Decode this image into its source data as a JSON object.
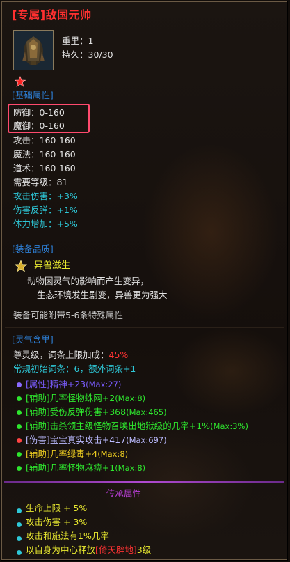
{
  "title": "[专属]敌国元帅",
  "weight": "重里：1",
  "durability": "持久：30/30",
  "basic": {
    "header": "[基础属性]",
    "lines": [
      "防御：0-160",
      "魔御：0-160",
      "攻击：160-160",
      "魔法：160-160",
      "道术：160-160",
      "需要等级：81"
    ],
    "bonus": [
      "攻击伤害：+3%",
      "伤害反弹：+1%",
      "体力增加：+5%"
    ]
  },
  "quality": {
    "header": "[装备品质]",
    "name": "异兽滋生",
    "desc1": "动物因灵气的影响而产生变异，",
    "desc2": "生态环境发生剧变，异兽更为强大",
    "note": "装备可能附带5-6条特殊属性"
  },
  "spirit": {
    "header": "[灵气含里]",
    "line1_prefix": "尊灵级，词条上限加成：",
    "line1_value": "45%",
    "line2": "常规初始词条：6，额外词条+1",
    "affixes": [
      {
        "text": "[属性]精神+23",
        "max": "(Max:27)",
        "color": "#7a5cff",
        "dot": "#8a6aff"
      },
      {
        "text": "[辅助]几率怪物蛛网+2",
        "max": "(Max:8)",
        "color": "#2ee62e",
        "dot": "#2ee62e"
      },
      {
        "text": "[辅助]受伤反弹伤害+368",
        "max": "(Max:465)",
        "color": "#2ee62e",
        "dot": "#2ee62e"
      },
      {
        "text": "[辅助]击杀领主级怪物召唤出地狱级的几率+1%",
        "max": "(Max:3%)",
        "color": "#2ee62e",
        "dot": "#2ee62e"
      },
      {
        "text": "[伤害]宝宝真实攻击+417",
        "max": "(Max:697)",
        "color": "#bbbbff",
        "dot": "#ff4444"
      },
      {
        "text": "[辅助]几率绿毒+4",
        "max": "(Max:8)",
        "color": "#e8c820",
        "dot": "#2ee62e"
      },
      {
        "text": "[辅助]几率怪物麻痹+1",
        "max": "(Max:8)",
        "color": "#2ee62e",
        "dot": "#2ee62e"
      }
    ]
  },
  "inherit": {
    "header": "传承属性",
    "lines": [
      "生命上限 + 5%",
      "攻击伤害 + 3%",
      "攻击和施法有1%几率"
    ],
    "last_prefix": "以自身为中心释放",
    "last_skill": "[倚天辟地]",
    "last_suffix": "3级"
  },
  "colors": {
    "title": "#ff3030",
    "header": "#2d7fd6",
    "cyan": "#2ec8d8",
    "green": "#2ee62e",
    "red": "#ff3333",
    "inherit_header": "#c040e0",
    "highlight": "#ff4a6e"
  },
  "icons": [
    "equipment-icon",
    "red-star-icon",
    "gold-star-icon"
  ]
}
